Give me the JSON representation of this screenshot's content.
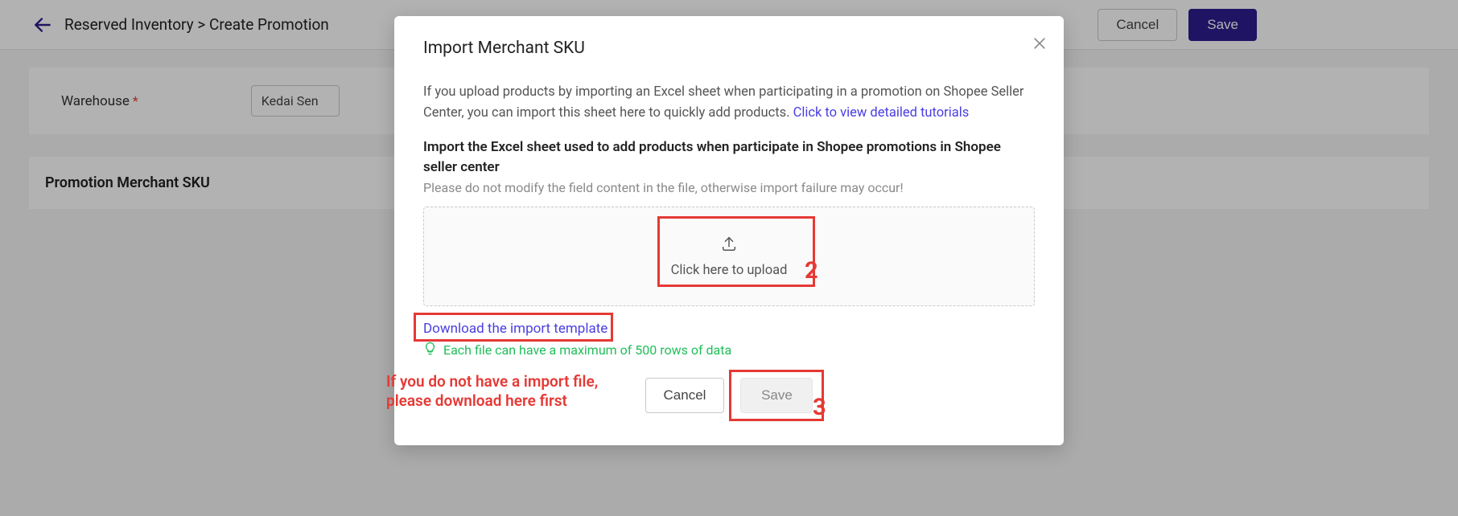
{
  "breadcrumb": {
    "parent": "Reserved Inventory",
    "sep": ">",
    "current": "Create Promotion"
  },
  "topbar": {
    "cancel": "Cancel",
    "save": "Save"
  },
  "form": {
    "warehouse_label": "Warehouse",
    "warehouse_value": "Kedai Sen"
  },
  "section": {
    "title": "Promotion Merchant SKU"
  },
  "modal": {
    "title": "Import Merchant SKU",
    "intro_text": "If you upload products by importing an Excel sheet when participating in a promotion on Shopee Seller Center, you can import this sheet here to quickly add products. ",
    "intro_link": "Click to view detailed tutorials",
    "subtitle": "Import the Excel sheet used to add products when participate in Shopee promotions in Shopee seller center",
    "note": "Please do not modify the field content in the file, otherwise import failure may occur!",
    "upload_text": "Click here to upload",
    "download_template": "Download the import template",
    "hint": "Each file can have a maximum of 500 rows of data",
    "cancel": "Cancel",
    "save": "Save"
  },
  "annotations": {
    "label2": "2",
    "label3": "3",
    "helper": "If you do not have a import file, please download here first"
  }
}
